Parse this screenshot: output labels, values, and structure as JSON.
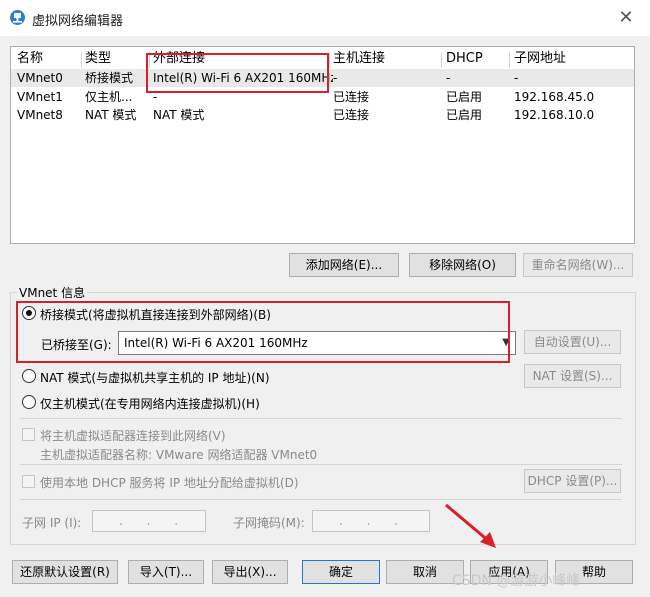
{
  "window": {
    "title": "虚拟网络编辑器",
    "close_glyph": "✕"
  },
  "table": {
    "headers": [
      "名称",
      "类型",
      "外部连接",
      "主机连接",
      "DHCP",
      "子网地址"
    ],
    "rows": [
      [
        "VMnet0",
        "桥接模式",
        "Intel(R) Wi-Fi 6 AX201 160MHz",
        "-",
        "-",
        "-"
      ],
      [
        "VMnet1",
        "仅主机...",
        "-",
        "已连接",
        "已启用",
        "192.168.45.0"
      ],
      [
        "VMnet8",
        "NAT 模式",
        "NAT 模式",
        "已连接",
        "已启用",
        "192.168.10.0"
      ]
    ],
    "selected_row": 0
  },
  "list_buttons": {
    "add": "添加网络(E)...",
    "remove": "移除网络(O)",
    "rename": "重命名网络(W)..."
  },
  "vmnet_info": {
    "group_label": "VMnet 信息",
    "bridged_label": "桥接模式(将虚拟机直接连接到外部网络)(B)",
    "bridged_to_label": "已桥接至(G):",
    "bridged_to_value": "Intel(R) Wi-Fi 6 AX201 160MHz",
    "auto_settings": "自动设置(U)...",
    "nat_label": "NAT 模式(与虚拟机共享主机的 IP 地址)(N)",
    "nat_settings": "NAT 设置(S)...",
    "hostonly_label": "仅主机模式(在专用网络内连接虚拟机)(H)",
    "connect_adapter": "将主机虚拟适配器连接到此网络(V)",
    "adapter_name": "主机虚拟适配器名称: VMware 网络适配器 VMnet0",
    "use_dhcp": "使用本地 DHCP 服务将 IP 地址分配给虚拟机(D)",
    "dhcp_settings": "DHCP 设置(P)...",
    "subnet_ip_label": "子网 IP (I):",
    "subnet_mask_label": "子网掩码(M):",
    "ip_placeholder": ".  .  ."
  },
  "footer_buttons": {
    "restore": "还原默认设置(R)",
    "import": "导入(T)...",
    "export": "导出(X)...",
    "ok": "确定",
    "cancel": "取消",
    "apply": "应用(A)",
    "help": "帮助"
  },
  "watermark": "CSDN @游游小峰峰",
  "colors": {
    "highlight": "#d6202a",
    "selected_row": "#e9e9e9"
  }
}
